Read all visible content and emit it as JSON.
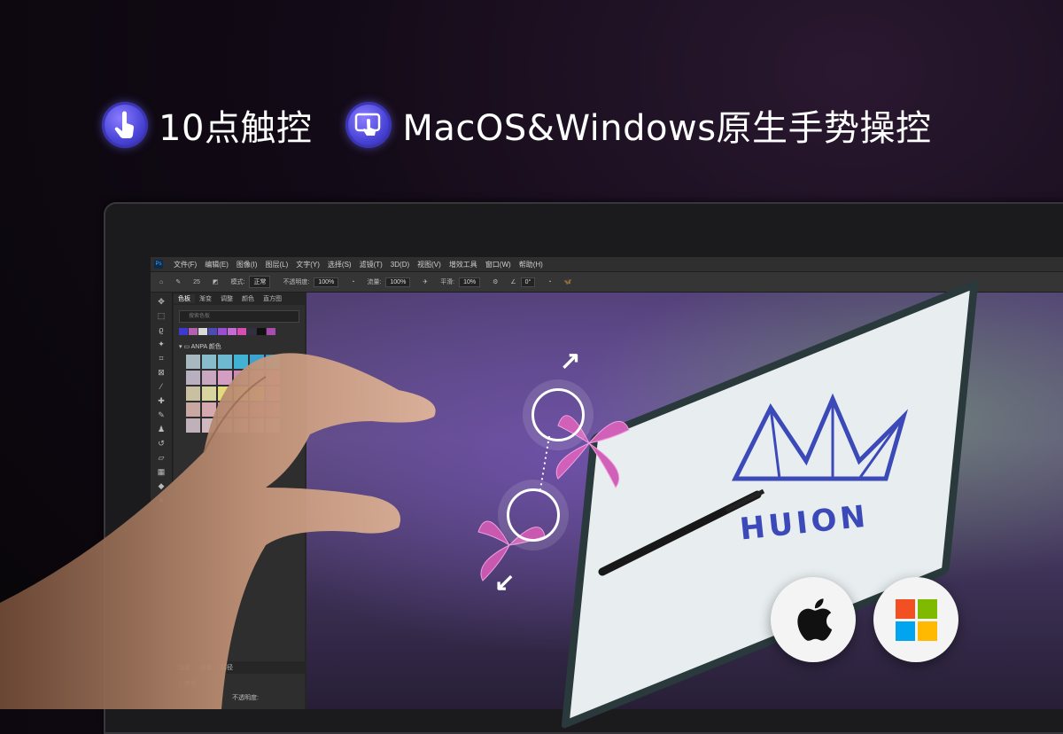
{
  "features": [
    {
      "icon": "touch-finger-icon",
      "label": "10点触控"
    },
    {
      "icon": "gesture-screen-icon",
      "label": "MacOS&Windows原生手势操控"
    }
  ],
  "app": {
    "menus": [
      "文件(F)",
      "编辑(E)",
      "图像(I)",
      "图层(L)",
      "文字(Y)",
      "选择(S)",
      "滤镜(T)",
      "3D(D)",
      "视图(V)",
      "增效工具",
      "窗口(W)",
      "帮助(H)"
    ],
    "options": {
      "brush_size": "25",
      "mode_label": "模式:",
      "mode_value": "正常",
      "opacity_label": "不透明度:",
      "opacity_value": "100%",
      "flow_label": "流量:",
      "flow_value": "100%",
      "smooth_label": "平滑:",
      "smooth_value": "10%",
      "angle_value": "0°"
    },
    "panel_tabs": [
      "色板",
      "渐变",
      "调整",
      "颜色",
      "直方图"
    ],
    "search_placeholder": "搜索色板",
    "swatch_group": "ANPA 颜色",
    "layer_tabs": [
      "图层",
      "通道",
      "路径"
    ],
    "layer_filter": "类型",
    "layer_opacity_label": "不透明度:"
  },
  "artwork_logo_text": "HUION",
  "colors": {
    "accent_icon": "#5b4fe6",
    "recent_swatches": [
      "#3b3bd0",
      "#b45fb0",
      "#d9d9d9",
      "#4b4bb5",
      "#9b4fd0",
      "#c66ad8",
      "#d64fb0",
      "#303040",
      "#111111",
      "#a84cb0"
    ],
    "swatches": [
      "#a7b8c0",
      "#89bccb",
      "#6fb9d0",
      "#42b2d4",
      "#3ba3d0",
      "#2a9ac8",
      "#b8b0c0",
      "#c8a8c0",
      "#d49ec2",
      "#d18ab7",
      "#cf6fa6",
      "#c8528f",
      "#c8c0a0",
      "#d8d4a0",
      "#e2da7c",
      "#e6d34e",
      "#d7bf3f",
      "#cc4f8a",
      "#c8a8a0",
      "#d6a8b0",
      "#d48aa8",
      "#c86f9a",
      "#bf5a8c",
      "#b34a7f",
      "#c0b0b8",
      "#d0b8c0",
      "#c8a0b0",
      "#b890a8",
      "#a8809c",
      "#98708f"
    ],
    "windows_logo": [
      "#f25022",
      "#7fba00",
      "#00a4ef",
      "#ffb900"
    ]
  },
  "os_badges": [
    "apple-logo-icon",
    "windows-logo-icon"
  ]
}
